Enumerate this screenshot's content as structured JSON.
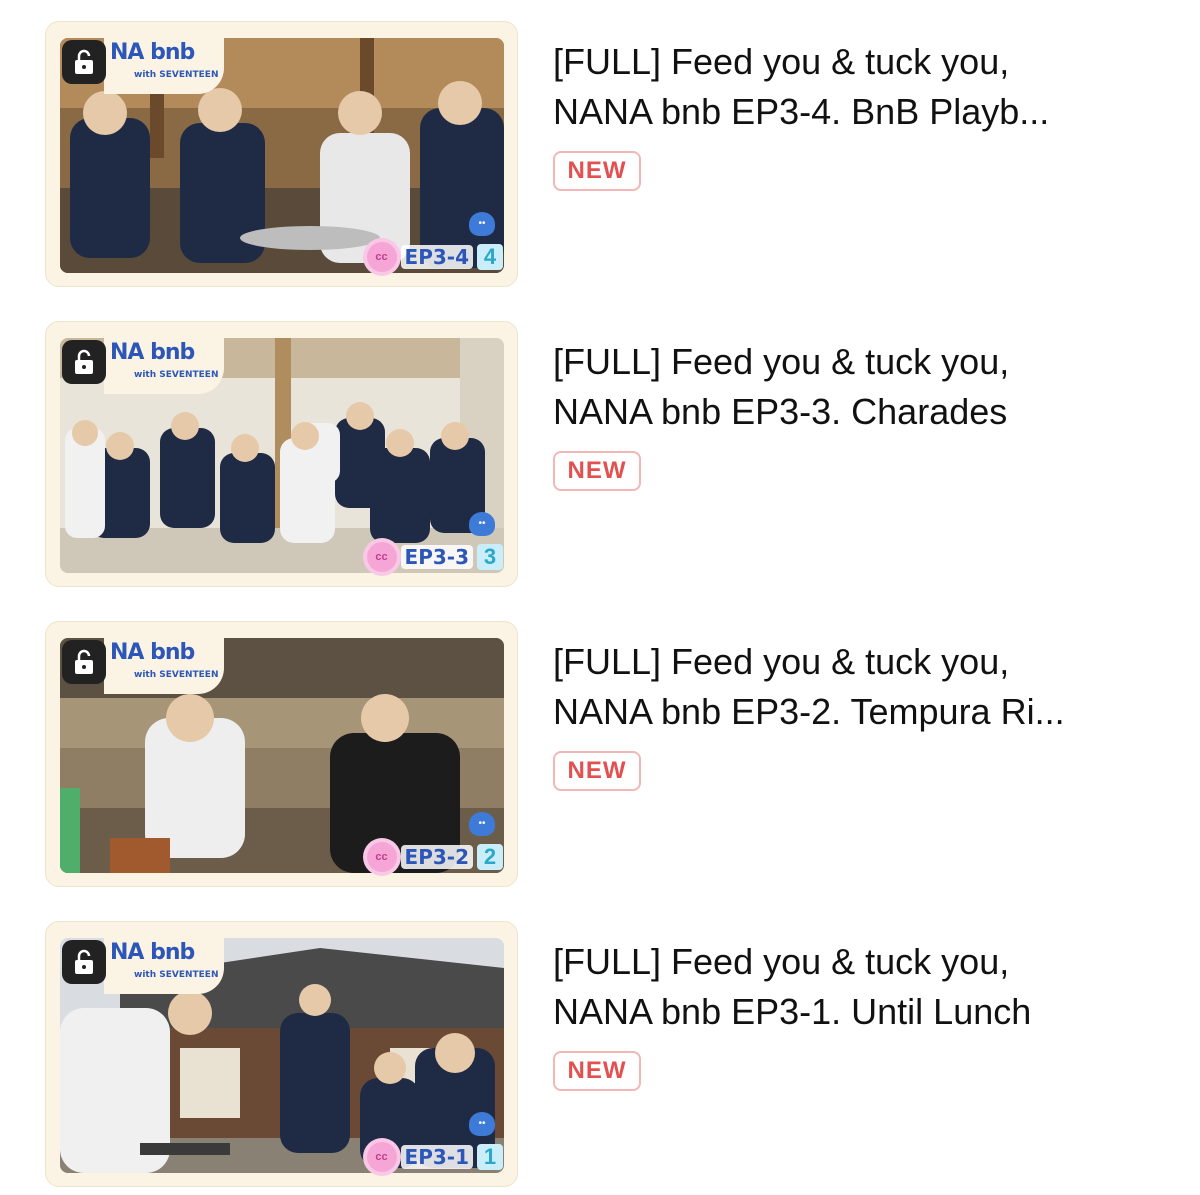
{
  "videos": [
    {
      "title": "[FULL] Feed you & tuck you,\nNANA bnb EP3-4. BnB Playb...",
      "badge": "NEW",
      "logo_text": "NA bnb",
      "logo_sub": "with SEVENTEEN",
      "episode_label": "EP3-4",
      "episode_num": "4",
      "locked": true
    },
    {
      "title": "[FULL] Feed you & tuck you,\nNANA bnb EP3-3. Charades",
      "badge": "NEW",
      "logo_text": "NA bnb",
      "logo_sub": "with SEVENTEEN",
      "episode_label": "EP3-3",
      "episode_num": "3",
      "locked": true
    },
    {
      "title": "[FULL] Feed you & tuck you,\nNANA bnb EP3-2. Tempura Ri...",
      "badge": "NEW",
      "logo_text": "NA bnb",
      "logo_sub": "with SEVENTEEN",
      "episode_label": "EP3-2",
      "episode_num": "2",
      "locked": true
    },
    {
      "title": " [FULL] Feed you & tuck you,\nNANA bnb EP3-1. Until Lunch",
      "badge": "NEW",
      "logo_text": "NA bnb",
      "logo_sub": "with SEVENTEEN",
      "episode_label": "EP3-1",
      "episode_num": "1",
      "locked": true
    }
  ],
  "colors": {
    "badge_text": "#e35050",
    "badge_border": "#f2b7b7",
    "card_bg": "#fbf3e3",
    "logo_blue": "#2c57b8"
  }
}
